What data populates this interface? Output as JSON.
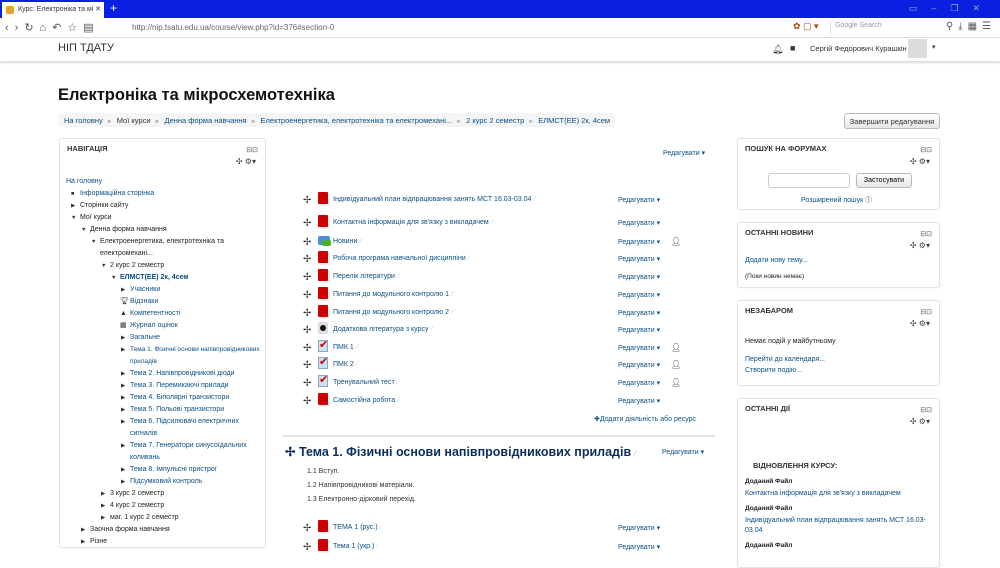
{
  "browser": {
    "tab_title": "Курс: Електроніка та мі",
    "url": "http://nip.tsatu.edu.ua/course/view.php?id=376#section-0",
    "search_placeholder": "Google Search"
  },
  "header": {
    "brand": "НІП ТДАТУ",
    "user_name": "Сергій Федорович Курашкін"
  },
  "page_title": "Електроніка та мікросхемотехніка",
  "breadcrumb": [
    "На головну",
    "Мої курси",
    "Денна форма навчання",
    "Електроенергетика, електротехніка та електромехані...",
    "2 курс 2 семестр",
    "ЕЛМСТ(ЕЕ) 2к, 4сем"
  ],
  "finish_editing": "Завершити редагування",
  "navigation": {
    "title": "НАВІГАЦІЯ",
    "items": [
      {
        "label": "На головну",
        "level": 0,
        "marker": "",
        "link": true
      },
      {
        "label": "Інформаційна сторінка",
        "level": 1,
        "marker": "bullet",
        "link": true
      },
      {
        "label": "Сторінки сайту",
        "level": 1,
        "marker": "collapsed"
      },
      {
        "label": "Мої курси",
        "level": 1,
        "marker": "expanded"
      },
      {
        "label": "Денна форма навчання",
        "level": 2,
        "marker": "expanded"
      },
      {
        "label": "Електроенергетика, електротехніка та електромехані...",
        "level": 3,
        "marker": "expanded"
      },
      {
        "label": "2 курс 2 семестр",
        "level": 4,
        "marker": "expanded"
      },
      {
        "label": "ЕЛМСТ(ЕЕ) 2к, 4сем",
        "level": 5,
        "marker": "expanded",
        "link": true,
        "bold": true
      },
      {
        "label": "Учасники",
        "level": 6,
        "marker": "collapsed",
        "link": true
      },
      {
        "label": "Відзнаки",
        "level": 6,
        "marker": "trophy",
        "link": true
      },
      {
        "label": "Компетентності",
        "level": 6,
        "marker": "competency",
        "link": true
      },
      {
        "label": "Журнал оцінок",
        "level": 6,
        "marker": "table",
        "link": true
      },
      {
        "label": "Загальне",
        "level": 6,
        "marker": "collapsed",
        "link": true
      },
      {
        "label": "Тема 1. Фізичні основи напівпровідникових приладів",
        "level": 6,
        "marker": "collapsed",
        "link": true
      },
      {
        "label": "Тема 2. Напівпровідникові діоди",
        "level": 6,
        "marker": "collapsed",
        "link": true
      },
      {
        "label": "Тема 3. Перемикаючі прилади",
        "level": 6,
        "marker": "collapsed",
        "link": true
      },
      {
        "label": "Тема 4. Біполярні транзистори",
        "level": 6,
        "marker": "collapsed",
        "link": true
      },
      {
        "label": "Тема 5. Польові транзистори",
        "level": 6,
        "marker": "collapsed",
        "link": true
      },
      {
        "label": "Тема 6. Підсилювачі електричних сигналів",
        "level": 6,
        "marker": "collapsed",
        "link": true
      },
      {
        "label": "Тема 7. Генератори синусоїдальних коливань",
        "level": 6,
        "marker": "collapsed",
        "link": true
      },
      {
        "label": "Тема 8. Імпульсні пристрої",
        "level": 6,
        "marker": "collapsed",
        "link": true
      },
      {
        "label": "Підсумковий контроль",
        "level": 6,
        "marker": "collapsed",
        "link": true
      },
      {
        "label": "3 курс 2 семестр",
        "level": 4,
        "marker": "collapsed"
      },
      {
        "label": "4 курс 2 семестр",
        "level": 4,
        "marker": "collapsed"
      },
      {
        "label": "маг. 1 курс 2 семестр",
        "level": 4,
        "marker": "collapsed"
      },
      {
        "label": "Заочна форма навчання",
        "level": 2,
        "marker": "collapsed"
      },
      {
        "label": "Різне",
        "level": 2,
        "marker": "collapsed"
      }
    ]
  },
  "center": {
    "edit_label": "Редагувати",
    "activities": [
      {
        "name": "Індивідуальний план відпрацювання занять МСТ 16.03-03.04",
        "icon": "pdf",
        "user": false
      },
      {
        "name": "Контактна інформація для зв'язку з викладачем",
        "icon": "pdf",
        "user": false
      },
      {
        "name": "Новини",
        "icon": "forum",
        "user": true
      },
      {
        "name": "Робоча програма навчальної дисципліни",
        "icon": "pdf",
        "user": false
      },
      {
        "name": "Перелік літератури",
        "icon": "pdf",
        "user": false
      },
      {
        "name": "Питання до модульного контролю 1",
        "icon": "pdf",
        "user": false
      },
      {
        "name": "Питання до модульного контролю 2",
        "icon": "pdf",
        "user": false
      },
      {
        "name": "Додаткова література з курсу",
        "icon": "url",
        "user": false
      },
      {
        "name": "ПМК 1",
        "icon": "quiz",
        "user": true
      },
      {
        "name": "ПМК 2",
        "icon": "quiz",
        "user": true
      },
      {
        "name": "Тренувальний тест",
        "icon": "quiz",
        "user": true
      },
      {
        "name": "Самостійна робота",
        "icon": "pdf",
        "user": false
      }
    ],
    "add_activity": "Додати діяльність або ресурс",
    "section1": {
      "title": "Тема 1. Фізичні основи напівпровідникових приладів",
      "summary": [
        "1.1 Вступ.",
        "1.2 Напівпровідникові матеріали.",
        "1.3 Електронно-дірковий перехід."
      ],
      "activities": [
        {
          "name": "ТЕМА 1 (рус.)",
          "icon": "pdf",
          "user": false
        },
        {
          "name": "Тема 1 (укр.)",
          "icon": "pdf",
          "user": false
        }
      ]
    }
  },
  "forum_search": {
    "title": "ПОШУК НА ФОРУМАХ",
    "input_value": "",
    "button": "Застосувати",
    "advanced": "Розширений пошук"
  },
  "latest_news": {
    "title": "ОСТАННІ НОВИНИ",
    "add_topic": "Додати нову тему...",
    "empty": "(Поки новин немає)"
  },
  "upcoming": {
    "title": "НЕЗАБАРОМ",
    "empty": "Немає подій у майбутньому",
    "calendar": "Перейти до календаря...",
    "new_event": "Створити подію..."
  },
  "recent_activity": {
    "title": "ОСТАННІ ДІЇ",
    "heading": "ВІДНОВЛЕННЯ КУРСУ:",
    "entries": [
      {
        "type": "Доданий Файл",
        "name": "Контактна інформація для зв'язку з викладачем"
      },
      {
        "type": "Доданий Файл",
        "name": "Індивідуальний план відпрацювання занять МСТ 16.03-03.04"
      },
      {
        "type": "Доданий Файл",
        "name": ""
      }
    ]
  }
}
